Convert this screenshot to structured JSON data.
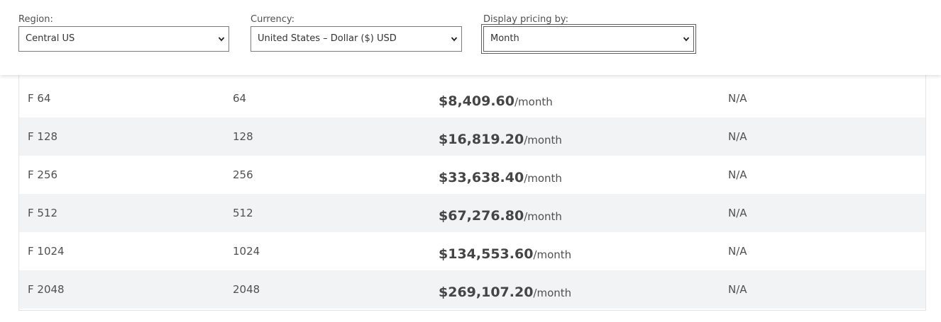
{
  "filters": {
    "region": {
      "label": "Region:",
      "value": "Central US"
    },
    "currency": {
      "label": "Currency:",
      "value": "United States – Dollar ($) USD"
    },
    "display_pricing": {
      "label": "Display pricing by:",
      "value": "Month"
    }
  },
  "pricing_table": {
    "rows": [
      {
        "instance": "F 64",
        "cores": "64",
        "price": "$8,409.60",
        "unit": "/month",
        "other": "N/A"
      },
      {
        "instance": "F 128",
        "cores": "128",
        "price": "$16,819.20",
        "unit": "/month",
        "other": "N/A"
      },
      {
        "instance": "F 256",
        "cores": "256",
        "price": "$33,638.40",
        "unit": "/month",
        "other": "N/A"
      },
      {
        "instance": "F 512",
        "cores": "512",
        "price": "$67,276.80",
        "unit": "/month",
        "other": "N/A"
      },
      {
        "instance": "F 1024",
        "cores": "1024",
        "price": "$134,553.60",
        "unit": "/month",
        "other": "N/A"
      },
      {
        "instance": "F 2048",
        "cores": "2048",
        "price": "$269,107.20",
        "unit": "/month",
        "other": "N/A"
      }
    ]
  },
  "icons": {
    "dropdown": "chevron-down-icon"
  }
}
